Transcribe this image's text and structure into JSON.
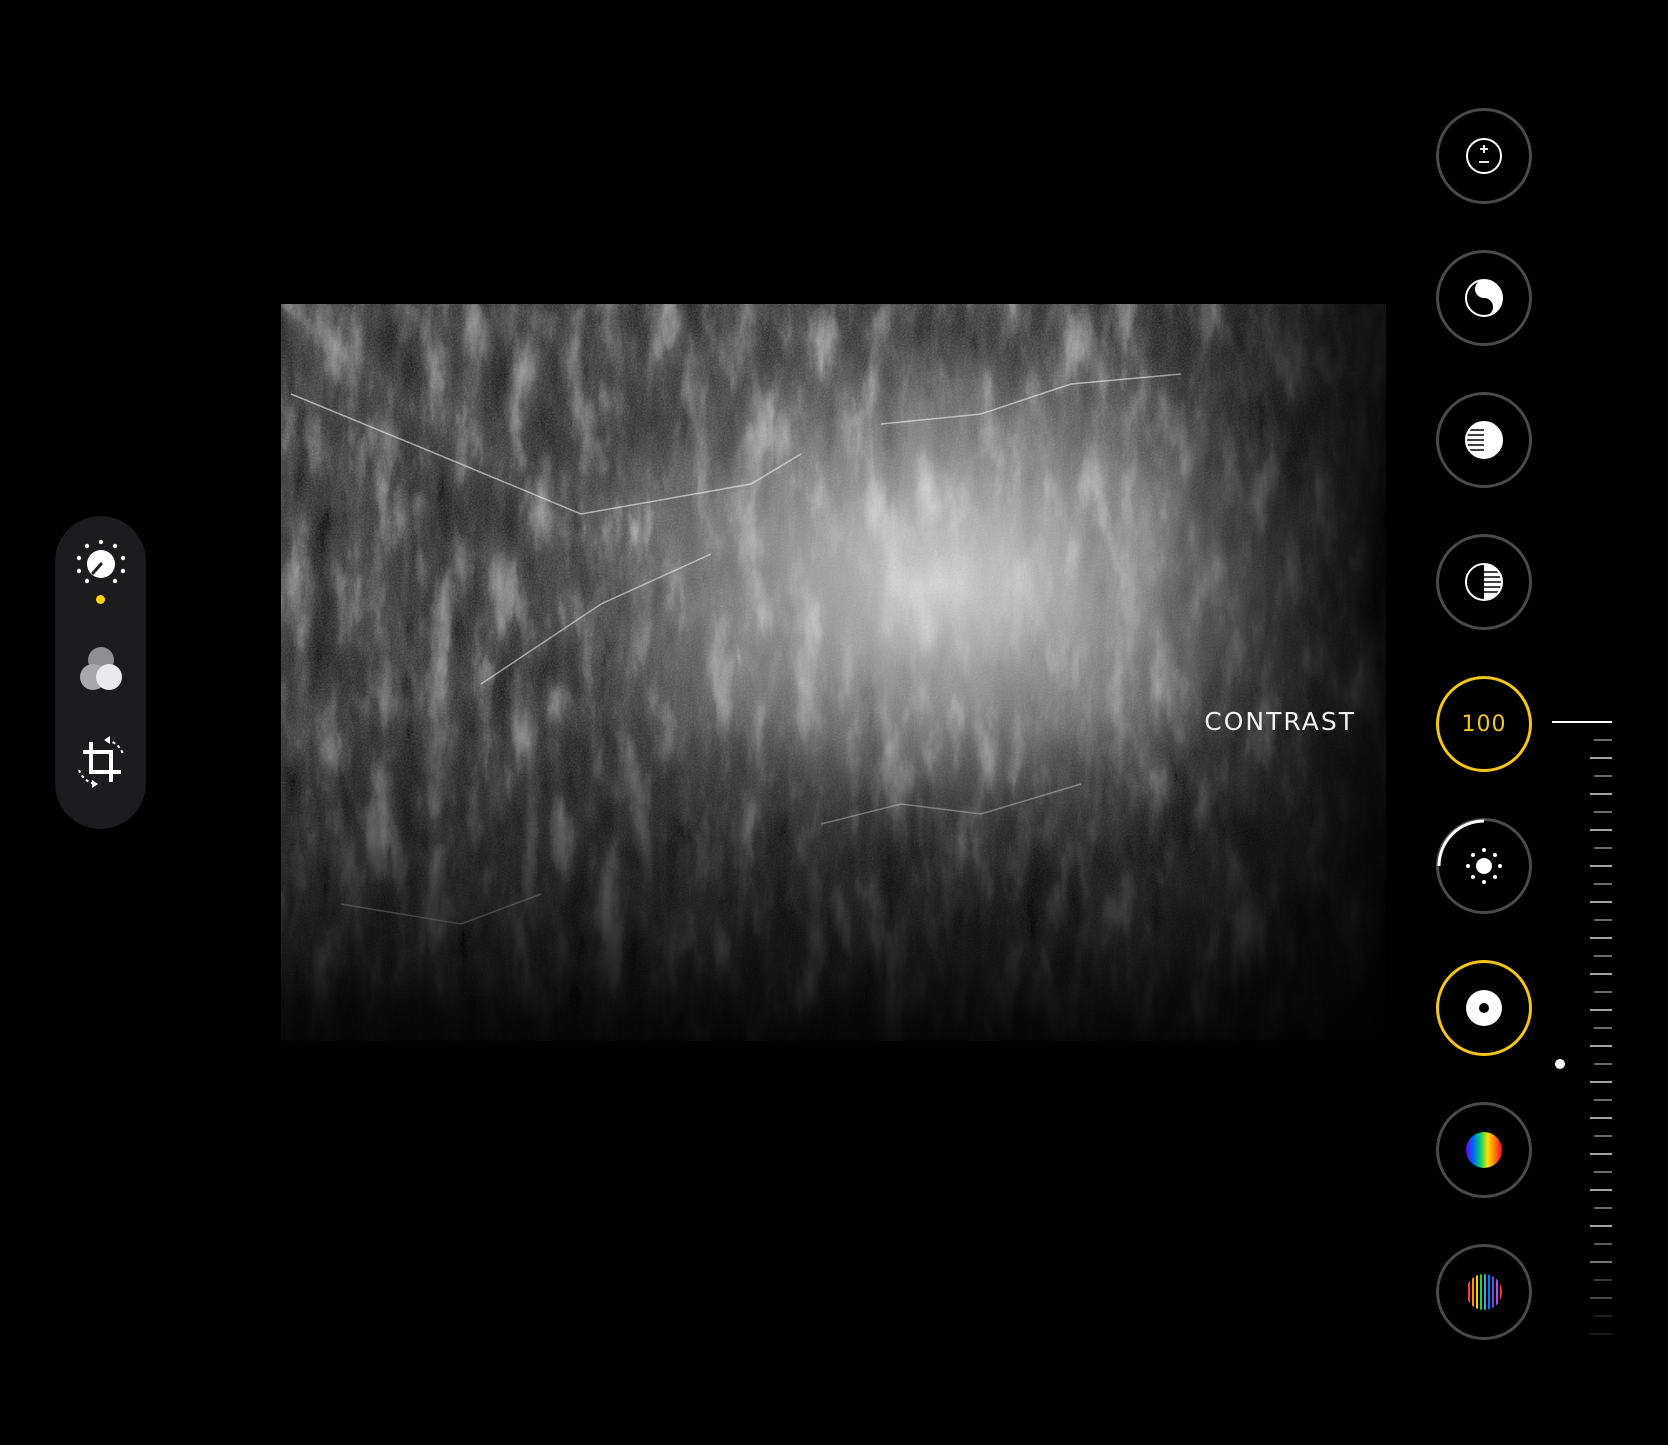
{
  "left_toolbar": {
    "tools": [
      {
        "name": "adjust",
        "icon": "adjust-dial-icon",
        "active": true
      },
      {
        "name": "filters",
        "icon": "filters-circles-icon",
        "active": false
      },
      {
        "name": "crop",
        "icon": "crop-rotate-icon",
        "active": false
      }
    ],
    "active_color": "#ffd60a"
  },
  "adjustment": {
    "label": "CONTRAST",
    "value": "100",
    "accent_color": "#f5c518"
  },
  "adjustments": [
    {
      "name": "exposure",
      "icon": "exposure-plus-minus-icon",
      "state": "default"
    },
    {
      "name": "brilliance",
      "icon": "brilliance-yin-yang-icon",
      "state": "default"
    },
    {
      "name": "highlights",
      "icon": "highlights-half-circle-icon",
      "state": "default"
    },
    {
      "name": "shadows",
      "icon": "shadows-half-circle-icon",
      "state": "default"
    },
    {
      "name": "contrast",
      "icon": "contrast-icon",
      "state": "selected",
      "value": "100"
    },
    {
      "name": "brightness",
      "icon": "brightness-sun-icon",
      "state": "partially-modified"
    },
    {
      "name": "black-point",
      "icon": "black-point-icon",
      "state": "modified"
    },
    {
      "name": "saturation",
      "icon": "saturation-gradient-icon",
      "state": "default"
    },
    {
      "name": "vibrance",
      "icon": "vibrance-stripes-icon",
      "state": "default"
    }
  ],
  "slider": {
    "value_percent": 100,
    "orientation": "vertical"
  }
}
